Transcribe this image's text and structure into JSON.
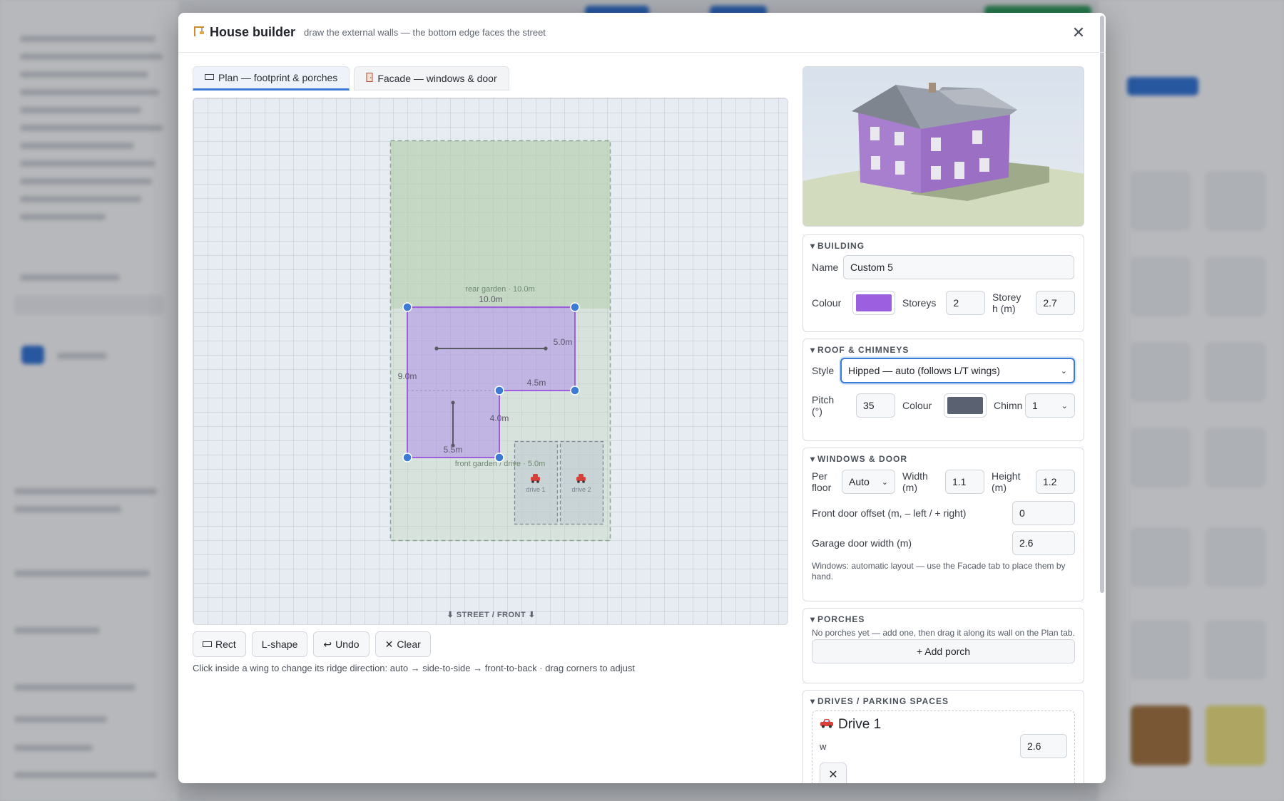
{
  "modal": {
    "icon": "house-construction-icon",
    "title": "House builder",
    "subtitle": "draw the external walls — the bottom edge faces the street",
    "close_symbol": "✕"
  },
  "tabs": [
    {
      "label": "Plan — footprint & porches",
      "icon": "plan-rect-icon",
      "active": true
    },
    {
      "label": "Facade — windows & door",
      "icon": "door-icon",
      "active": false
    }
  ],
  "plan": {
    "rear_garden_label": "rear garden · 10.0m",
    "front_garden_label": "front garden / drive · 5.0m",
    "dimensions": {
      "top": "10.0m",
      "right_upper": "5.0m",
      "left": "9.0m",
      "inner_horizontal": "4.5m",
      "inner_vertical": "4.0m",
      "bottom": "5.5m"
    },
    "drives": [
      {
        "label": "drive 1",
        "icon": "car-icon"
      },
      {
        "label": "drive 2",
        "icon": "car-icon"
      }
    ],
    "street_label": "⬇ STREET / FRONT ⬇"
  },
  "toolbar": {
    "rect": {
      "icon": "rect-icon",
      "label": "Rect"
    },
    "lshape": {
      "label": "L-shape"
    },
    "undo": {
      "icon": "undo-icon",
      "label": "Undo"
    },
    "clear": {
      "icon": "clear-icon",
      "label": "Clear"
    }
  },
  "hint": "Click inside a wing to change its ridge direction: auto → side-to-side → front-to-back · drag corners to adjust",
  "building": {
    "section_title": "BUILDING",
    "name_label": "Name",
    "name_value": "Custom 5",
    "colour_label": "Colour",
    "colour_value": "#9b5fe0",
    "storeys_label": "Storeys",
    "storeys_value": "2",
    "storey_h_label_1": "Storey",
    "storey_h_label_2": "h (m)",
    "storey_h_value": "2.7"
  },
  "roof": {
    "section_title": "ROOF & CHIMNEYS",
    "style_label": "Style",
    "style_value": "Hipped — auto (follows L/T wings)",
    "pitch_label_1": "Pitch",
    "pitch_label_2": "(°)",
    "pitch_value": "35",
    "colour_label": "Colour",
    "colour_value": "#5a6170",
    "chimneys_label": "Chimn",
    "chimneys_value": "1"
  },
  "windows": {
    "section_title": "WINDOWS & DOOR",
    "per_floor_label_1": "Per",
    "per_floor_label_2": "floor",
    "per_floor_value": "Auto",
    "width_label_1": "Width",
    "width_label_2": "(m)",
    "width_value": "1.1",
    "height_label_1": "Height",
    "height_label_2": "(m)",
    "height_value": "1.2",
    "door_offset_label": "Front door offset (m, – left / + right)",
    "door_offset_value": "0",
    "garage_label": "Garage door width (m)",
    "garage_value": "2.6",
    "note": "Windows: automatic layout — use the Facade tab to place them by hand."
  },
  "porches": {
    "section_title": "PORCHES",
    "note": "No porches yet — add one, then drag it along its wall on the Plan tab.",
    "add_label": "+ Add porch"
  },
  "drives_panel": {
    "section_title": "DRIVES / PARKING SPACES",
    "drive_title": "Drive 1",
    "drive_icon": "car-icon",
    "w_label": "w",
    "w_value": "2.6",
    "remove_symbol": "✕"
  },
  "colors": {
    "accent": "#3b7bd6",
    "footprint": "#9b5fe0",
    "handle": "#3b7bd6"
  }
}
